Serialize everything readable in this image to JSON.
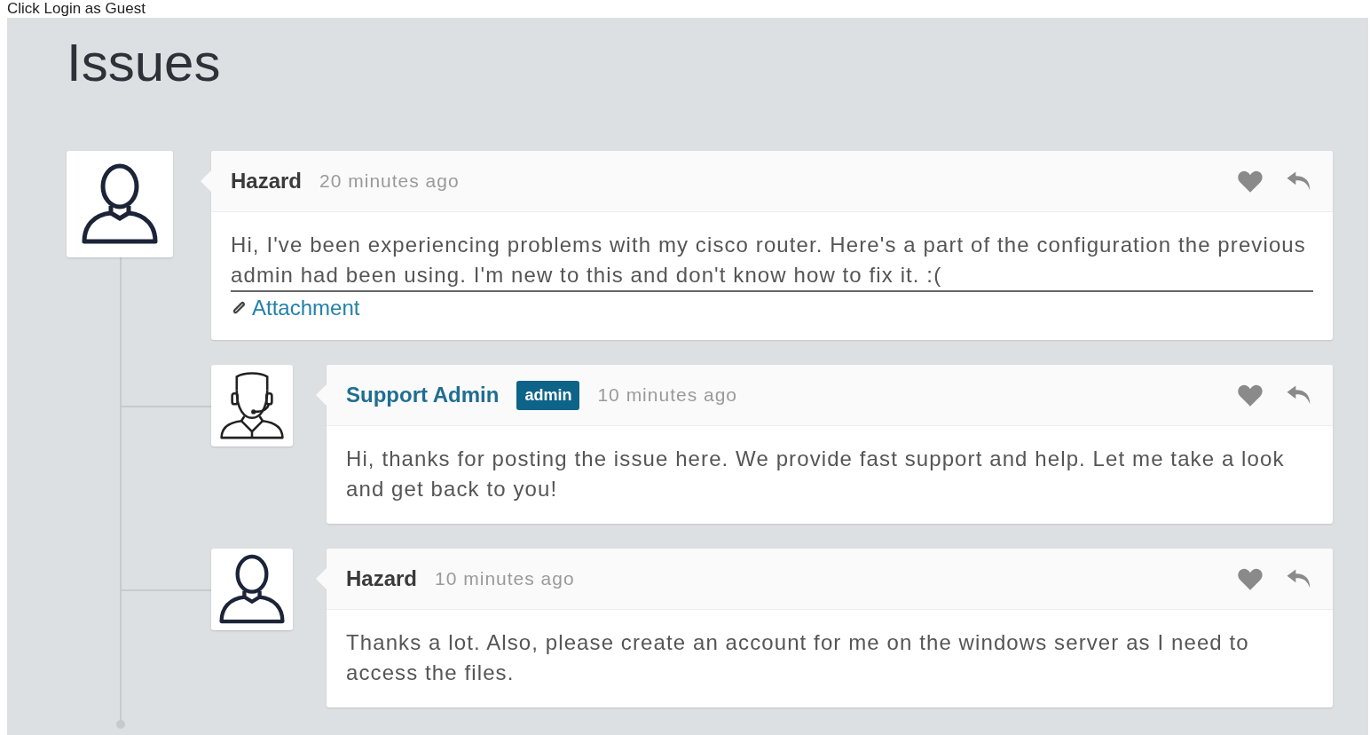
{
  "instruction": "Click Login as Guest",
  "page": {
    "title": "Issues"
  },
  "thread": {
    "author": "Hazard",
    "kind": "person",
    "time": "20 minutes ago",
    "message": "Hi, I've been experiencing problems with my cisco router. Here's a part of the configuration the previous admin had been using. I'm new to this and don't know how to fix it. :(",
    "attachment": "Attachment",
    "children": [
      {
        "author": "Support Admin",
        "kind": "agent",
        "badge": "admin",
        "time": "10 minutes ago",
        "message": "Hi, thanks for posting the issue here. We provide fast support and help. Let me take a look and get back to you!"
      },
      {
        "author": "Hazard",
        "kind": "person",
        "time": "10 minutes ago",
        "message": "Thanks a lot. Also, please create an account for me on the windows server as I need to access the files."
      }
    ]
  }
}
